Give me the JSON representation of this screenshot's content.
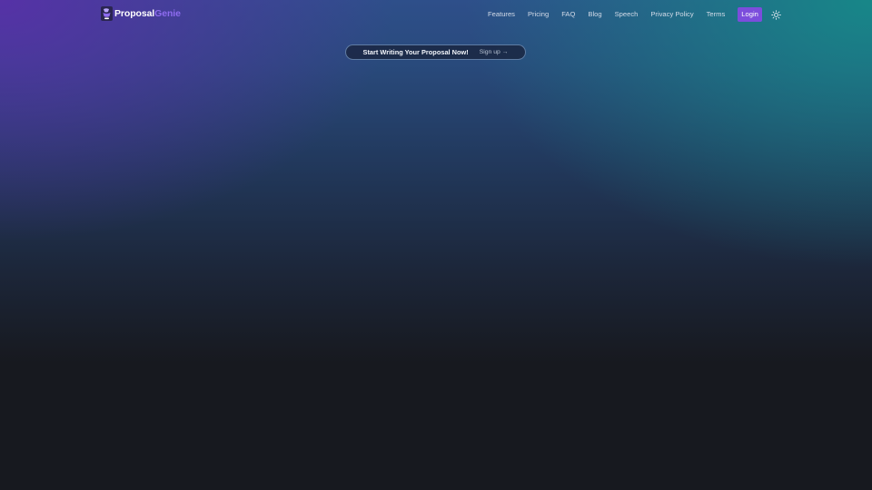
{
  "brand": {
    "name_primary": "Proposal",
    "name_accent": "Genie",
    "logo_icon": "genie-lamp-icon",
    "accent_color": "#8e6cf0"
  },
  "nav": {
    "items": [
      {
        "label": "Features"
      },
      {
        "label": "Pricing"
      },
      {
        "label": "FAQ"
      },
      {
        "label": "Blog"
      },
      {
        "label": "Speech"
      },
      {
        "label": "Privacy Policy"
      },
      {
        "label": "Terms"
      }
    ],
    "login_label": "Login",
    "login_color": "#7c4ddc",
    "theme_toggle_icon": "sun-icon"
  },
  "hero": {
    "cta_text": "Start Writing Your Proposal Now!",
    "cta_link_label": "Sign up →"
  },
  "theme": {
    "background": "#17191f",
    "gradient_left": "#5830a8",
    "gradient_right": "#168a88"
  }
}
